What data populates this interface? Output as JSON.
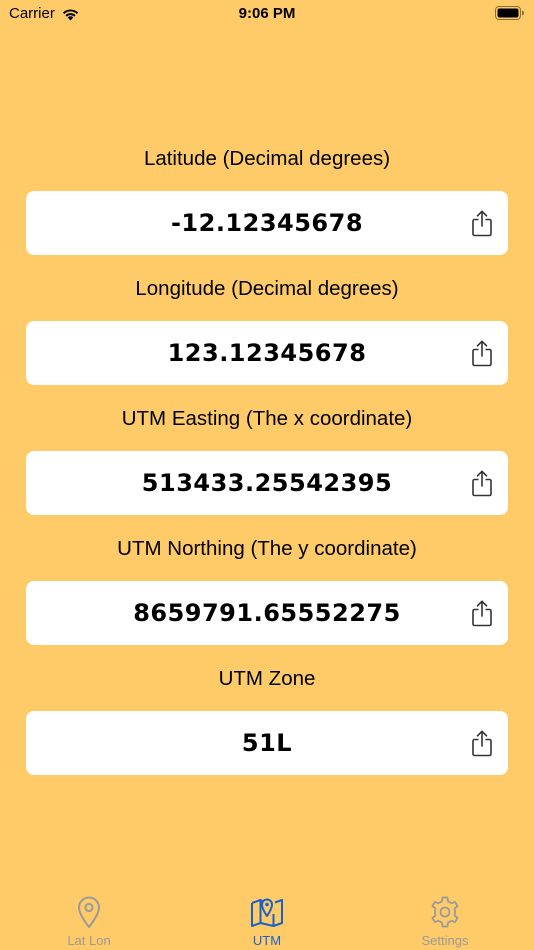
{
  "status_bar": {
    "carrier": "Carrier",
    "time": "9:06 PM"
  },
  "fields": [
    {
      "label": "Latitude (Decimal degrees)",
      "value": "-12.12345678"
    },
    {
      "label": "Longitude (Decimal degrees)",
      "value": "123.12345678"
    },
    {
      "label": "UTM Easting (The x coordinate)",
      "value": "513433.25542395"
    },
    {
      "label": "UTM Northing (The y coordinate)",
      "value": "8659791.65552275"
    },
    {
      "label": "UTM Zone",
      "value": "51L"
    }
  ],
  "tabs": [
    {
      "label": "Lat Lon",
      "icon": "location-pin-icon",
      "active": false
    },
    {
      "label": "UTM",
      "icon": "map-icon",
      "active": true
    },
    {
      "label": "Settings",
      "icon": "gear-icon",
      "active": false
    }
  ],
  "colors": {
    "background": "#FECB68",
    "active_tab": "#1B62C8",
    "inactive_tab": "#9A9A9A"
  }
}
